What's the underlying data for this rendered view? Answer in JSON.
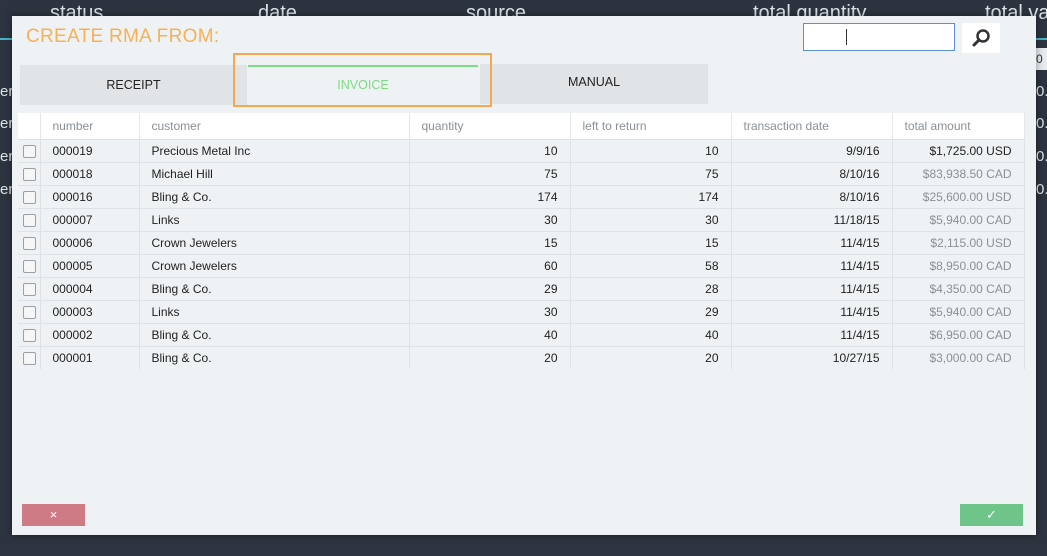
{
  "background": {
    "headers": [
      "status",
      "date",
      "source",
      "total quantity",
      "total va"
    ],
    "row_prefixes": [
      "er",
      "er",
      "er",
      "er"
    ],
    "row_suffixes": [
      "0.",
      "0.",
      "0.",
      "0."
    ],
    "box_text": "0"
  },
  "modal": {
    "title": "CREATE RMA FROM:",
    "search": {
      "value": "",
      "placeholder": ""
    },
    "tabs": [
      {
        "label": "RECEIPT",
        "active": false
      },
      {
        "label": "INVOICE",
        "active": true
      },
      {
        "label": "MANUAL",
        "active": false
      }
    ],
    "table": {
      "columns": [
        "number",
        "customer",
        "quantity",
        "left to return",
        "transaction date",
        "total amount"
      ],
      "rows": [
        {
          "number": "000019",
          "customer": "Precious Metal Inc",
          "quantity": "10",
          "left": "10",
          "date": "9/9/16",
          "amount": "$1,725.00 USD"
        },
        {
          "number": "000018",
          "customer": "Michael Hill",
          "quantity": "75",
          "left": "75",
          "date": "8/10/16",
          "amount": "$83,938.50 CAD"
        },
        {
          "number": "000016",
          "customer": "Bling & Co.",
          "quantity": "174",
          "left": "174",
          "date": "8/10/16",
          "amount": "$25,600.00 USD"
        },
        {
          "number": "000007",
          "customer": "Links",
          "quantity": "30",
          "left": "30",
          "date": "11/18/15",
          "amount": "$5,940.00 CAD"
        },
        {
          "number": "000006",
          "customer": "Crown Jewelers",
          "quantity": "15",
          "left": "15",
          "date": "11/4/15",
          "amount": "$2,115.00 USD"
        },
        {
          "number": "000005",
          "customer": "Crown Jewelers",
          "quantity": "60",
          "left": "58",
          "date": "11/4/15",
          "amount": "$8,950.00 CAD"
        },
        {
          "number": "000004",
          "customer": "Bling & Co.",
          "quantity": "29",
          "left": "28",
          "date": "11/4/15",
          "amount": "$4,350.00 CAD"
        },
        {
          "number": "000003",
          "customer": "Links",
          "quantity": "30",
          "left": "29",
          "date": "11/4/15",
          "amount": "$5,940.00 CAD"
        },
        {
          "number": "000002",
          "customer": "Bling & Co.",
          "quantity": "40",
          "left": "40",
          "date": "11/4/15",
          "amount": "$6,950.00 CAD"
        },
        {
          "number": "000001",
          "customer": "Bling & Co.",
          "quantity": "20",
          "left": "20",
          "date": "10/27/15",
          "amount": "$3,000.00 CAD"
        }
      ]
    },
    "cancel_label": "×",
    "confirm_label": "✓"
  },
  "colors": {
    "title": "#f7b155",
    "active_tab": "#7ddb84",
    "highlight_border": "#f5a84f",
    "cancel": "#cf7b86",
    "confirm": "#6fc48a",
    "search_border": "#5c8edb"
  }
}
